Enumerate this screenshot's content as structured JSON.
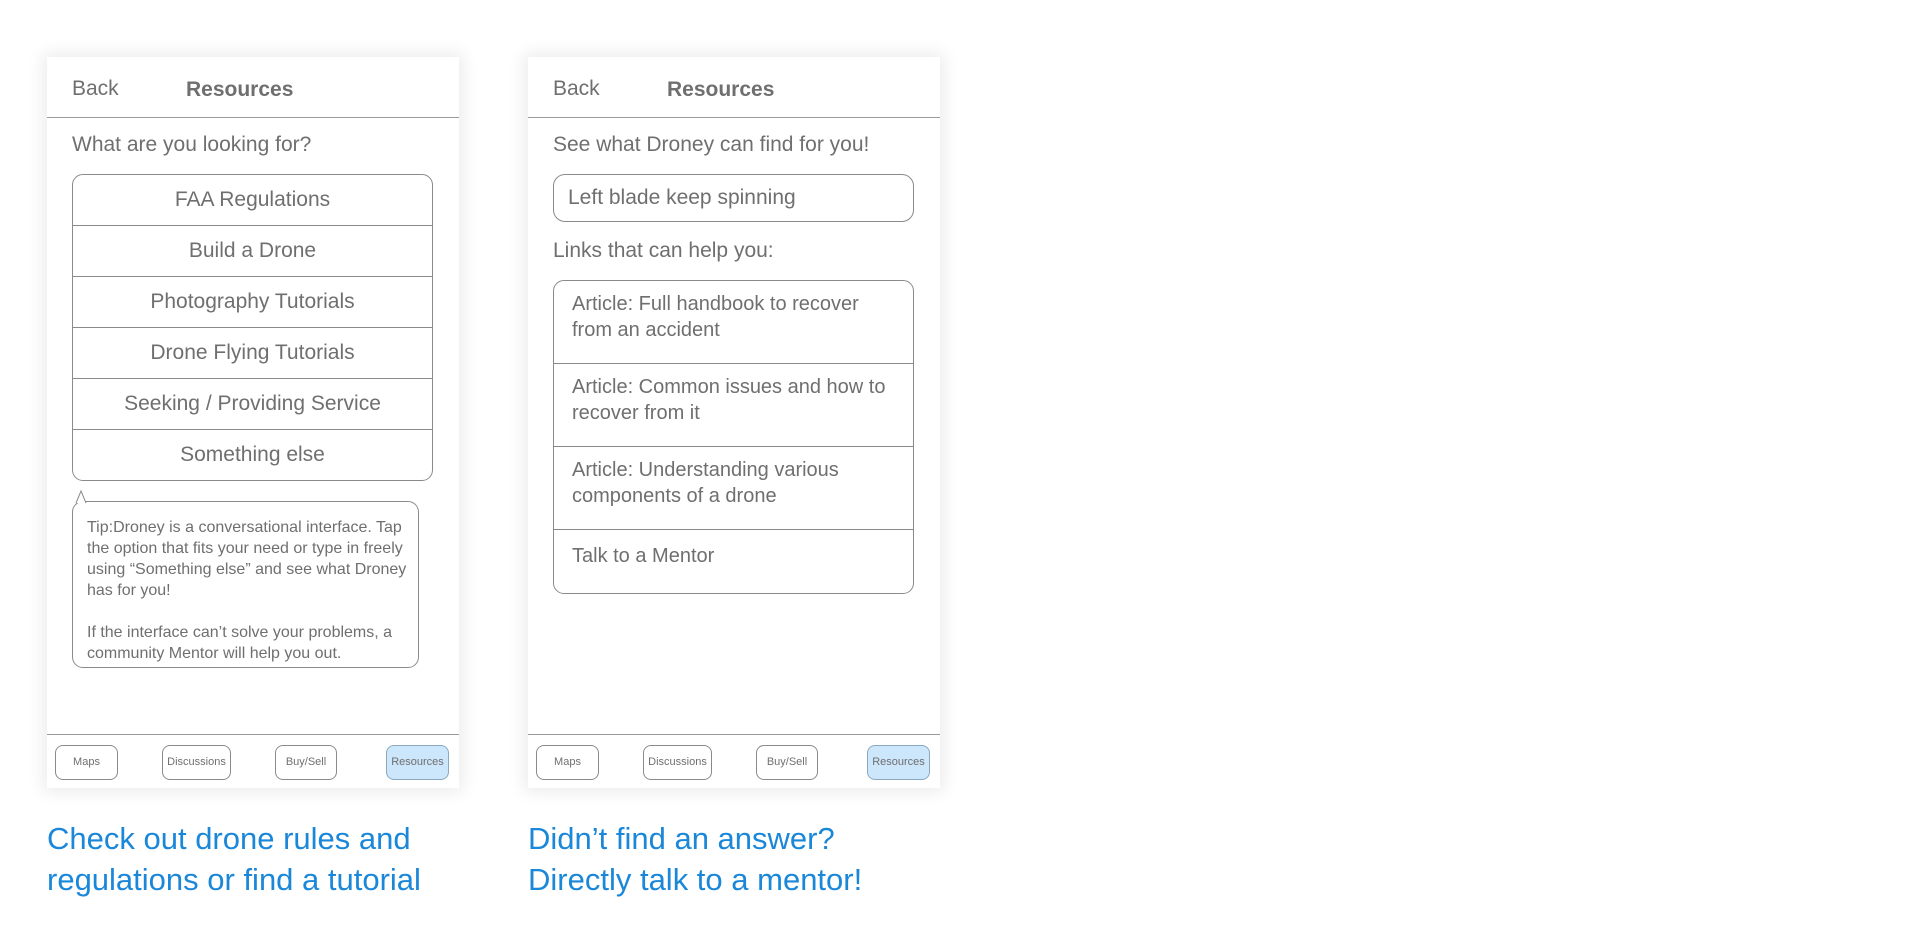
{
  "screen1": {
    "back": "Back",
    "title": "Resources",
    "prompt": "What are you looking for?",
    "options": [
      "FAA Regulations",
      "Build a Drone",
      "Photography Tutorials",
      "Drone Flying Tutorials",
      "Seeking / Providing Service",
      "Something else"
    ],
    "tip": {
      "para1": "Tip:Droney is a conversational interface. Tap the option that fits your need or type in freely using “Something else” and see what Droney has for you!",
      "para2": "If the interface can’t solve your problems, a community Mentor will help you out."
    },
    "tabs": [
      "Maps",
      "Discussions",
      "Buy/Sell",
      "Resources"
    ]
  },
  "screen2": {
    "back": "Back",
    "title": "Resources",
    "prompt": "See what Droney can find for you!",
    "search_value": "Left blade keep spinning",
    "links_heading": "Links that can help you:",
    "links": [
      "Article: Full handbook to recover from an accident",
      "Article: Common issues and how to recover from it",
      "Article: Understanding various components of a drone",
      "Talk to a Mentor"
    ],
    "tabs": [
      "Maps",
      "Discussions",
      "Buy/Sell",
      "Resources"
    ]
  },
  "captions": {
    "left": [
      "Check out drone rules and",
      "regulations or find a tutorial"
    ],
    "right": [
      "Didn’t find an answer?",
      "Directly talk to a mentor!"
    ]
  },
  "colors": {
    "caption": "#1a87d9",
    "active_tab": "#cce6fb",
    "text": "#6f6f6f"
  },
  "active_tab": "Resources"
}
